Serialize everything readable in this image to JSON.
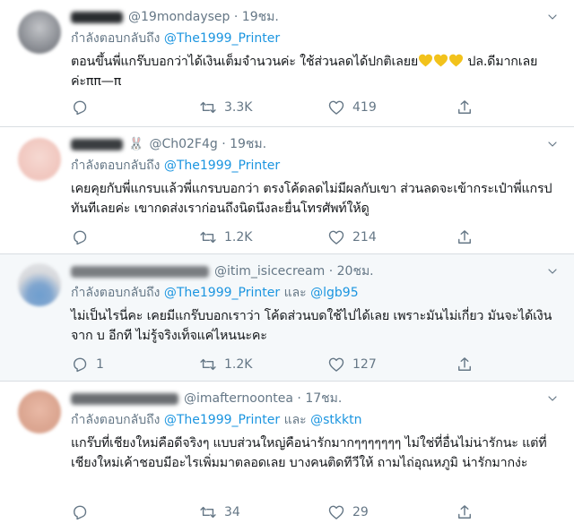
{
  "tweets": [
    {
      "handle": "@19mondaysep",
      "time": "19ชม.",
      "reply_prefix": "กำลังตอบกลับถึง",
      "reply_to": "@The1999_Printer",
      "reply_and": "",
      "reply_to2": "",
      "text_a": "ตอนขึ้นพี่แกร๊บบอกว่าได้เงินเต็มจำนวนค่ะ ใช้ส่วนลดได้ปกติเลยย",
      "text_b": " ปล.ดีมากเลยค่ะ",
      "text_c": "ππ—π",
      "reply_count": "",
      "retweet_count": "3.3K",
      "like_count": "419",
      "heart_emoji_color": "#f2c21b"
    },
    {
      "handle": "@Ch02F4g",
      "time": "19ชม.",
      "reply_prefix": "กำลังตอบกลับถึง",
      "reply_to": "@The1999_Printer",
      "reply_and": "",
      "reply_to2": "",
      "text": "เคยคุยกับพี่แกรบแล้วพี่แกรบบอกว่า ตรงโค้ดลดไม่มีผลกับเขา ส่วนลดจะเข้ากระเป๋าพี่แกรปทันทีเลยค่ะ เขากดส่งเราก่อนถึงนิดนึงละยื่นโทรศัพท์ให้ดู",
      "reply_count": "",
      "retweet_count": "1.2K",
      "like_count": "214"
    },
    {
      "handle": "@itim_isicecream",
      "time": "20ชม.",
      "reply_prefix": "กำลังตอบกลับถึง",
      "reply_to": "@The1999_Printer",
      "reply_and": "และ",
      "reply_to2": "@lgb95",
      "text": "ไม่เป็นไรนี่คะ เคยมีแกร๊บบอกเราว่า โค้ดส่วนบดใช้ไปได้เลย เพราะมันไม่เกี่ยว มันจะได้เงินจาก บ อีกที ไม่รู้จริงเท็จแค่ไหนนะคะ",
      "reply_count": "1",
      "retweet_count": "1.2K",
      "like_count": "127"
    },
    {
      "handle": "@imafternoontea",
      "time": "17ชม.",
      "reply_prefix": "กำลังตอบกลับถึง",
      "reply_to": "@The1999_Printer",
      "reply_and": "และ",
      "reply_to2": "@stkktn",
      "text": "แกร๊บที่เชียงใหม่คือดีจริงๆ แบบส่วนใหญ่คือน่ารักมากๆๆๆๆๆๆๆ ไม่ใช่ที่อื่นไม่น่ารักนะ แต่ที่เชียงใหม่เค้าชอบมีอะไรเพิ่มมาตลอดเลย บางคนติดทีวีให้ ถามไถ่อุณหภูมิ น่ารักมากง่ะ",
      "reply_count": "",
      "retweet_count": "34",
      "like_count": "29"
    }
  ],
  "colors": {
    "link": "#1b95e0",
    "muted": "#657786",
    "highlight_bg": "#f5f8fa"
  }
}
